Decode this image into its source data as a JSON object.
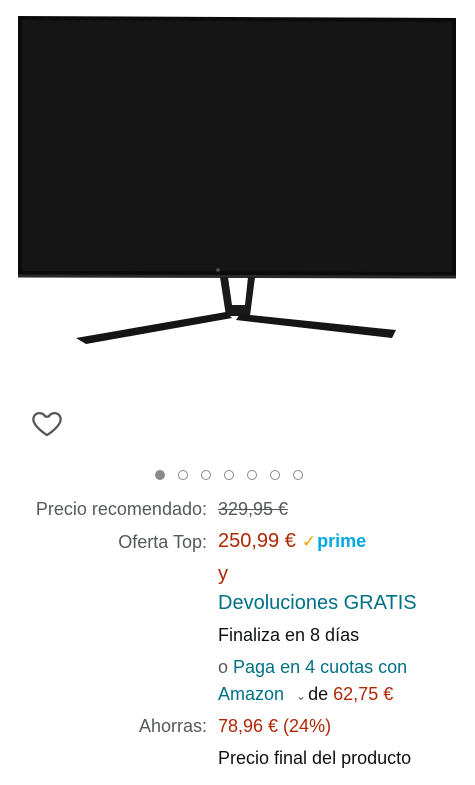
{
  "product": {
    "image_alt": "curved-monitor"
  },
  "gallery": {
    "dot_count": 7,
    "active_index": 0
  },
  "pricing": {
    "list_price_label": "Precio recomendado:",
    "list_price": "329,95 €",
    "deal_label": "Oferta Top:",
    "deal_price": "250,99 €",
    "prime_badge": "prime",
    "and_text": "y",
    "returns_text": "Devoluciones GRATIS",
    "ends_text": "Finaliza en 8 días",
    "installments_prefix": "o",
    "installments_link_line1": "Paga en 4 cuotas con",
    "installments_link_line2": "Amazon",
    "installments_of": "de",
    "installment_amount": "62,75 €",
    "savings_label": "Ahorras:",
    "savings_value": "78,96 € (24%)",
    "final_price_text": "Precio final del producto"
  },
  "colors": {
    "price": "#b12704",
    "link": "#007185",
    "prime": "#00a8e1"
  }
}
